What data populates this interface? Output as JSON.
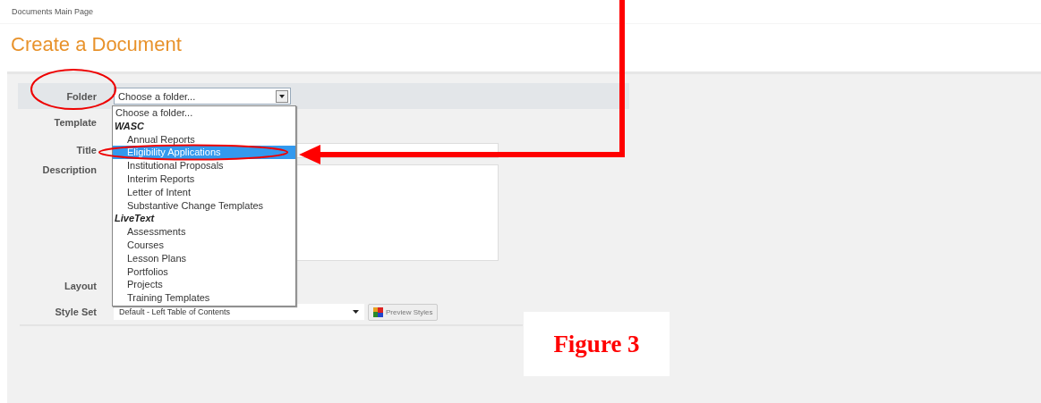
{
  "breadcrumb": "Documents Main Page",
  "title": "Create a Document",
  "form": {
    "labels": [
      "Folder",
      "Template",
      "Title",
      "Description",
      "Layout",
      "Style Set"
    ],
    "folder_select": {
      "value": "Choose a folder...",
      "expanded": true
    },
    "folder_options": [
      {
        "kind": "option",
        "label": "Choose a folder...",
        "selected": false
      },
      {
        "kind": "group",
        "label": "WASC",
        "children": [
          {
            "label": "Annual Reports",
            "selected": false
          },
          {
            "label": "Eligibility Applications",
            "selected": true
          },
          {
            "label": "Institutional Proposals",
            "selected": false
          },
          {
            "label": "Interim Reports",
            "selected": false
          },
          {
            "label": "Letter of Intent",
            "selected": false
          },
          {
            "label": "Substantive Change Templates",
            "selected": false
          }
        ]
      },
      {
        "kind": "group",
        "label": "LiveText",
        "children": [
          {
            "label": "Assessments",
            "selected": false
          },
          {
            "label": "Courses",
            "selected": false
          },
          {
            "label": "Lesson Plans",
            "selected": false
          },
          {
            "label": "Portfolios",
            "selected": false
          },
          {
            "label": "Projects",
            "selected": false
          },
          {
            "label": "Training Templates",
            "selected": false
          }
        ]
      }
    ],
    "style_set": "Default - Left Table of Contents",
    "preview_button": "Preview Styles"
  },
  "figure_label": "Figure 3"
}
